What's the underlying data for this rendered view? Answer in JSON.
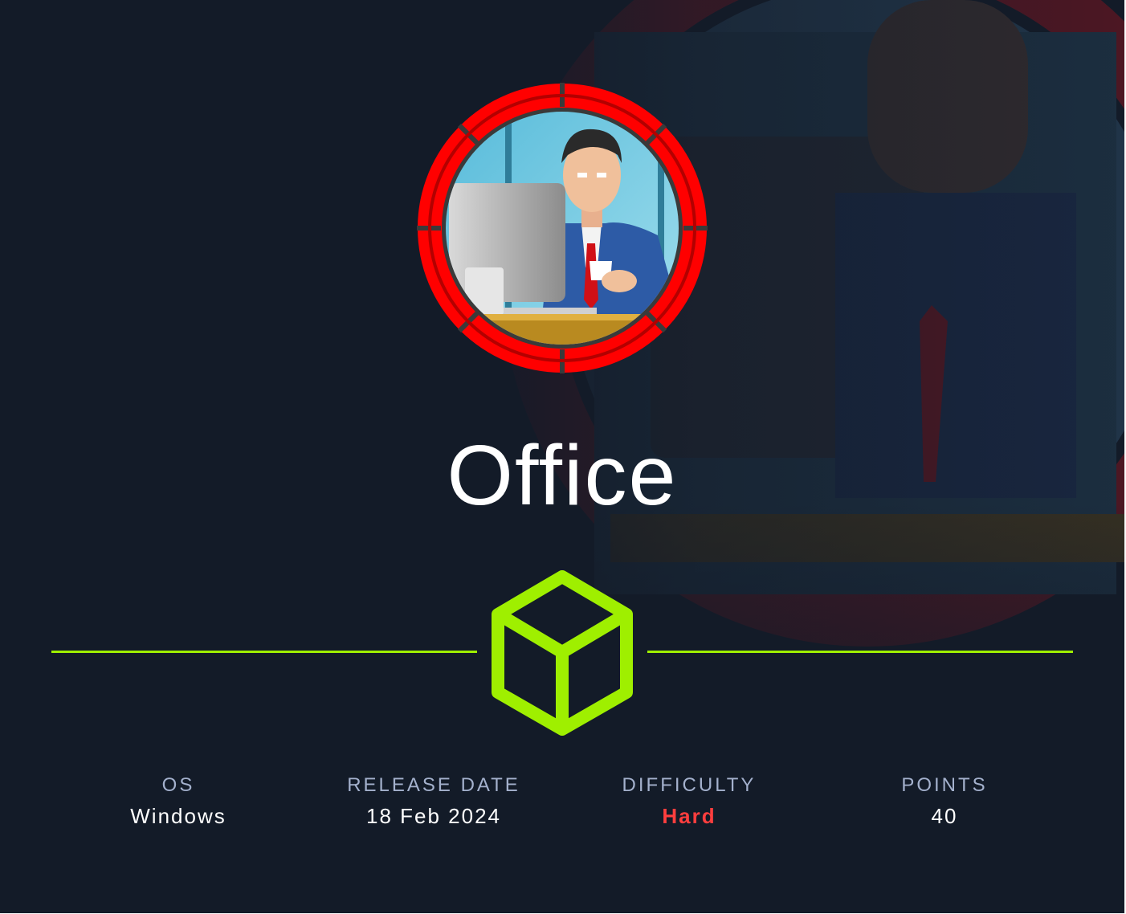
{
  "machine": {
    "name": "Office",
    "avatar_icon": "office-worker-avatar-icon",
    "badge_icon": "machine-cube-icon"
  },
  "stats": [
    {
      "label": "OS",
      "value": "Windows"
    },
    {
      "label": "RELEASE DATE",
      "value": "18 Feb 2024"
    },
    {
      "label": "DIFFICULTY",
      "value": "Hard"
    },
    {
      "label": "POINTS",
      "value": "40"
    }
  ],
  "colors": {
    "background": "#131b28",
    "accent_green": "#9fef00",
    "difficulty_hard": "#ff3e3e",
    "label_text": "#a4b1cd",
    "avatar_ring": "#ff0000"
  }
}
